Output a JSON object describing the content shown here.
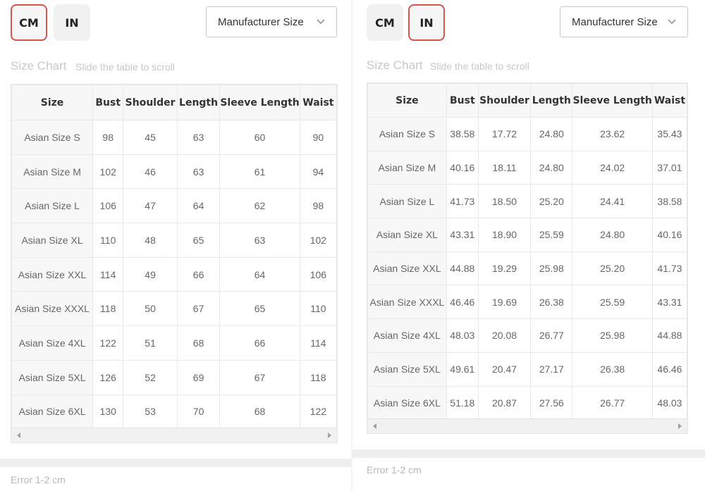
{
  "left": {
    "units": {
      "cm": "CM",
      "in": "IN",
      "active": "cm"
    },
    "manufacturer_select": "Manufacturer Size",
    "section_title": "Size Chart",
    "section_hint": "Slide the table to scroll",
    "headers": [
      "Size",
      "Bust",
      "Shoulder",
      "Length",
      "Sleeve Length",
      "Waist"
    ],
    "rows": [
      [
        "Asian Size S",
        "98",
        "45",
        "63",
        "60",
        "90"
      ],
      [
        "Asian Size M",
        "102",
        "46",
        "63",
        "61",
        "94"
      ],
      [
        "Asian Size L",
        "106",
        "47",
        "64",
        "62",
        "98"
      ],
      [
        "Asian Size XL",
        "110",
        "48",
        "65",
        "63",
        "102"
      ],
      [
        "Asian Size XXL",
        "114",
        "49",
        "66",
        "64",
        "106"
      ],
      [
        "Asian Size XXXL",
        "118",
        "50",
        "67",
        "65",
        "110"
      ],
      [
        "Asian Size 4XL",
        "122",
        "51",
        "68",
        "66",
        "114"
      ],
      [
        "Asian Size 5XL",
        "126",
        "52",
        "69",
        "67",
        "118"
      ],
      [
        "Asian Size 6XL",
        "130",
        "53",
        "70",
        "68",
        "122"
      ]
    ],
    "error_note": "Error 1-2 cm"
  },
  "right": {
    "units": {
      "cm": "CM",
      "in": "IN",
      "active": "in"
    },
    "manufacturer_select": "Manufacturer Size",
    "section_title": "Size Chart",
    "section_hint": "Slide the table to scroll",
    "headers": [
      "Size",
      "Bust",
      "Shoulder",
      "Length",
      "Sleeve Length",
      "Waist"
    ],
    "rows": [
      [
        "Asian Size S",
        "38.58",
        "17.72",
        "24.80",
        "23.62",
        "35.43"
      ],
      [
        "Asian Size M",
        "40.16",
        "18.11",
        "24.80",
        "24.02",
        "37.01"
      ],
      [
        "Asian Size L",
        "41.73",
        "18.50",
        "25.20",
        "24.41",
        "38.58"
      ],
      [
        "Asian Size XL",
        "43.31",
        "18.90",
        "25.59",
        "24.80",
        "40.16"
      ],
      [
        "Asian Size XXL",
        "44.88",
        "19.29",
        "25.98",
        "25.20",
        "41.73"
      ],
      [
        "Asian Size XXXL",
        "46.46",
        "19.69",
        "26.38",
        "25.59",
        "43.31"
      ],
      [
        "Asian Size 4XL",
        "48.03",
        "20.08",
        "26.77",
        "25.98",
        "44.88"
      ],
      [
        "Asian Size 5XL",
        "49.61",
        "20.47",
        "27.17",
        "26.38",
        "46.46"
      ],
      [
        "Asian Size 6XL",
        "51.18",
        "20.87",
        "27.56",
        "26.77",
        "48.03"
      ]
    ],
    "error_note": "Error 1-2 cm"
  },
  "icons": {
    "dropdown": "chevron-down-icon",
    "scroll_left": "scroll-left-arrow-icon",
    "scroll_right": "scroll-right-arrow-icon"
  },
  "colors": {
    "active_border": "#d9534f",
    "button_bg": "#f1f1f1",
    "muted_text": "#c8c8c8"
  }
}
